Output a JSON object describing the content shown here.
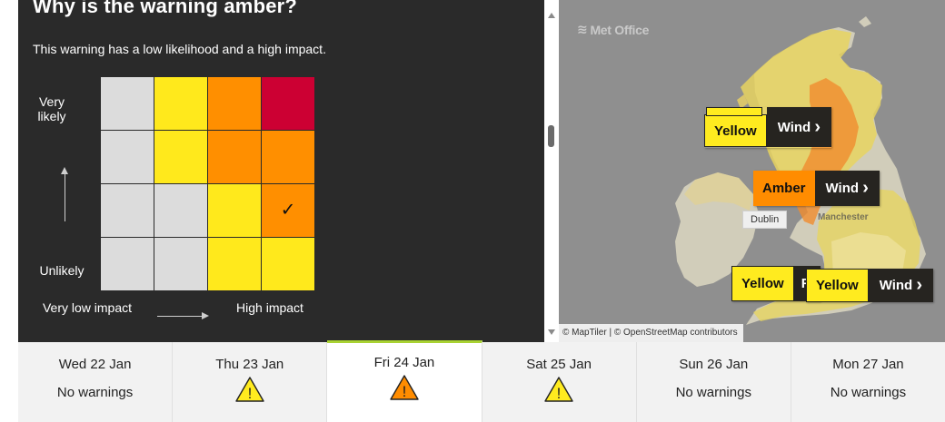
{
  "panel": {
    "title": "Why is the warning amber?",
    "subtitle": "This warning has a low likelihood and a high impact.",
    "y_top_label": "Very likely",
    "y_bottom_label": "Unlikely",
    "x_left_label": "Very low impact",
    "x_right_label": "High impact",
    "matrix_rows": [
      [
        "#dcdcdc",
        "#ffe91c",
        "#ff8f00",
        "#cc0033"
      ],
      [
        "#dcdcdc",
        "#ffe91c",
        "#ff8f00",
        "#ff8f00"
      ],
      [
        "#dcdcdc",
        "#dcdcdc",
        "#ffe91c",
        "#ff8f00"
      ],
      [
        "#dcdcdc",
        "#dcdcdc",
        "#ffe91c",
        "#ffe91c"
      ]
    ],
    "selected_cell": {
      "row": 2,
      "col": 3
    },
    "check_symbol": "✓"
  },
  "map": {
    "logo": "Met Office",
    "attribution": "© MapTiler | © OpenStreetMap contributors",
    "cities": {
      "dublin": "Dublin",
      "manchester": "Manchester"
    },
    "warnings": [
      {
        "level": "Yellow",
        "type": "Wind",
        "chevron": "›"
      },
      {
        "level": "Amber",
        "type": "Wind",
        "chevron": "›"
      },
      {
        "level": "Yellow",
        "type": "R"
      },
      {
        "level": "Yellow",
        "type": "Wind",
        "chevron": "›"
      }
    ],
    "colors": {
      "yellow": "#ffeb1f",
      "amber": "#ff8c00",
      "land": "#d1cdba"
    }
  },
  "days": [
    {
      "date": "Wed 22 Jan",
      "status": "No warnings"
    },
    {
      "date": "Thu 23 Jan",
      "warning_icon": "yellow-warning-icon",
      "icon_symbol": "!"
    },
    {
      "date": "Fri 24 Jan",
      "warning_icon": "amber-warning-icon",
      "icon_symbol": "!",
      "active": true
    },
    {
      "date": "Sat 25 Jan",
      "warning_icon": "yellow-warning-icon",
      "icon_symbol": "!"
    },
    {
      "date": "Sun 26 Jan",
      "status": "No warnings"
    },
    {
      "date": "Mon 27 Jan",
      "status": "No warnings"
    }
  ],
  "colors": {
    "active_tab_border": "#a8d232",
    "panel_bg": "#2a2a2a"
  }
}
